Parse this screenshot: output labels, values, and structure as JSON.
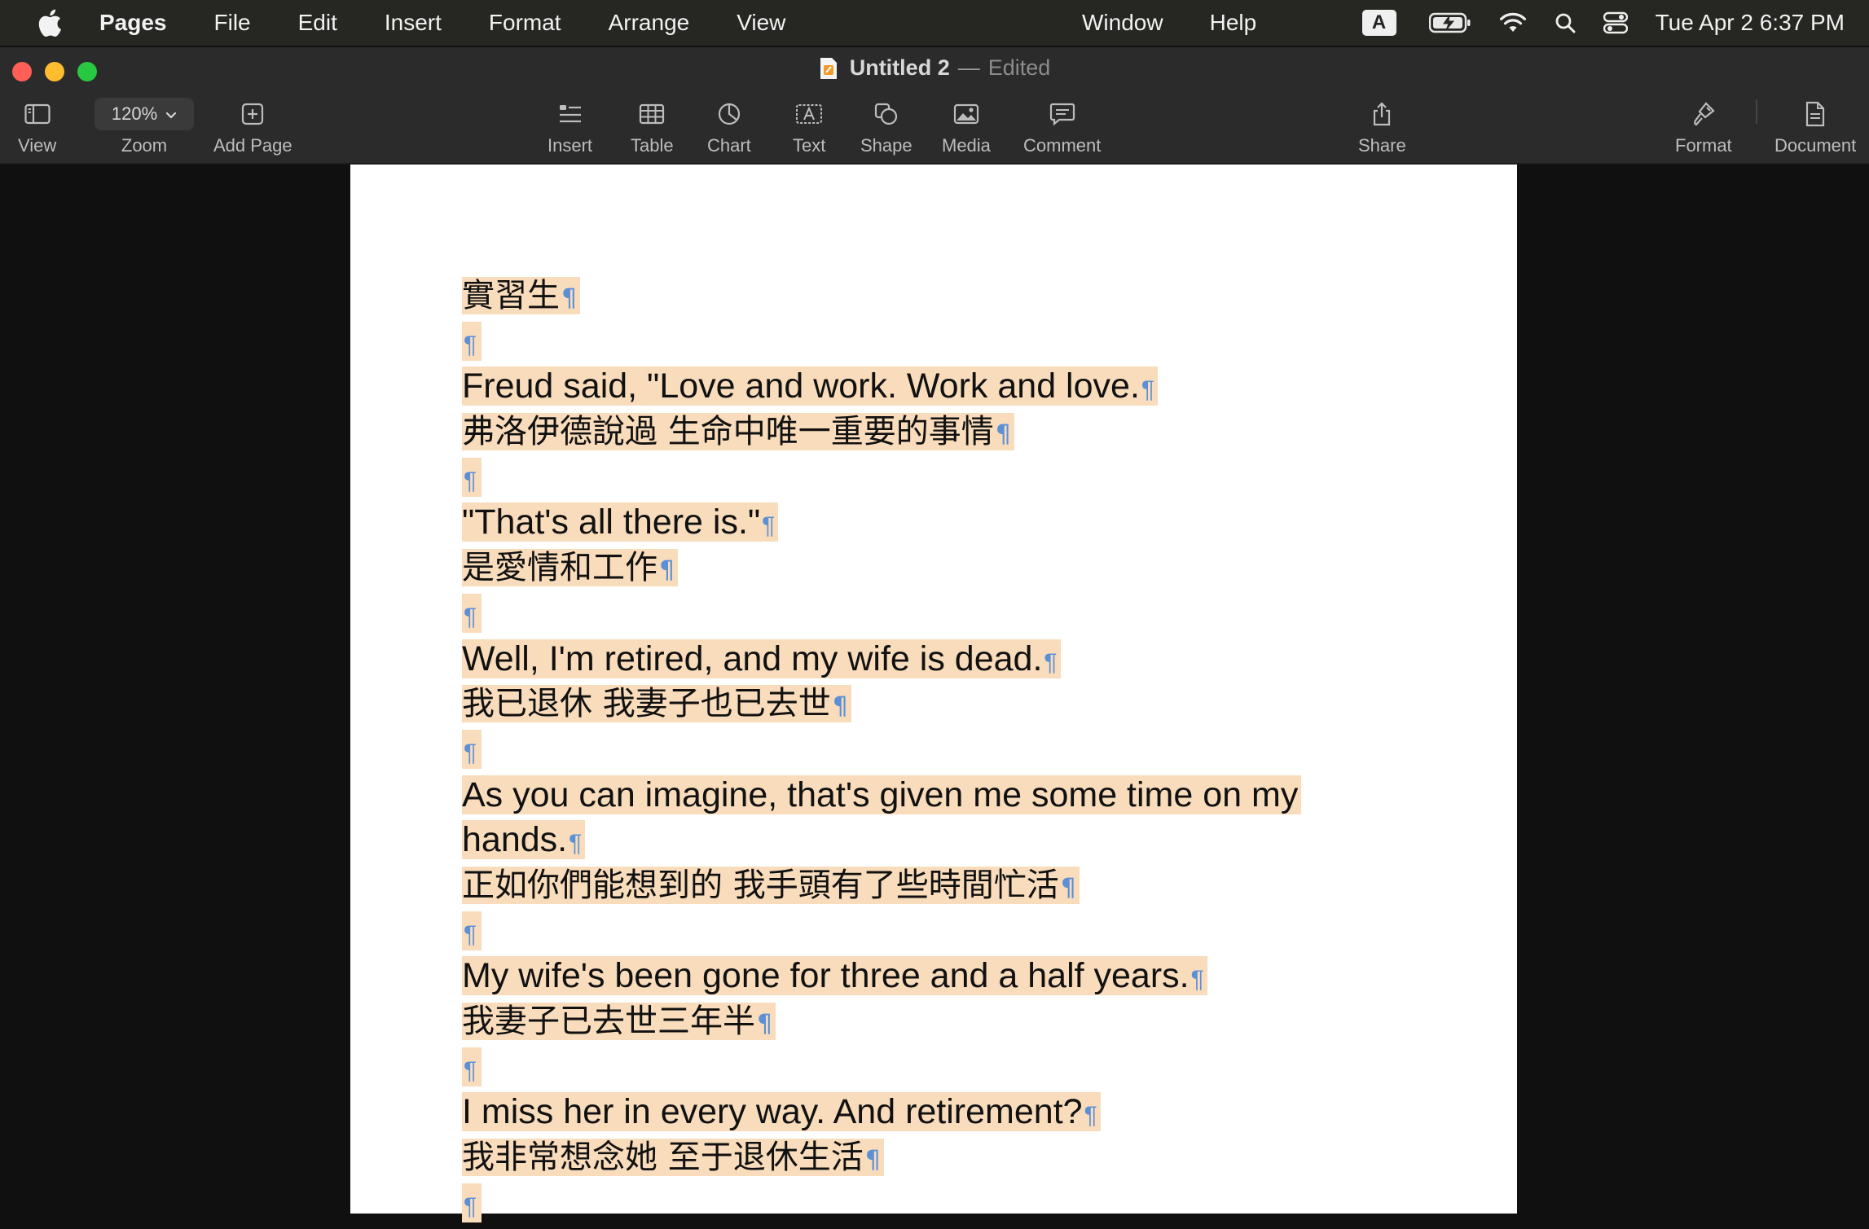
{
  "menubar": {
    "app_name": "Pages",
    "menus": [
      "File",
      "Edit",
      "Insert",
      "Format",
      "Arrange",
      "View"
    ],
    "right_menus": [
      "Window",
      "Help"
    ],
    "input_source": "A",
    "clock": "Tue Apr 2  6:37 PM"
  },
  "window": {
    "title": "Untitled 2",
    "separator": "—",
    "status": "Edited"
  },
  "toolbar": {
    "view_label": "View",
    "zoom_value": "120%",
    "zoom_label": "Zoom",
    "add_page_label": "Add Page",
    "insert_label": "Insert",
    "table_label": "Table",
    "chart_label": "Chart",
    "text_label": "Text",
    "shape_label": "Shape",
    "media_label": "Media",
    "comment_label": "Comment",
    "share_label": "Share",
    "format_label": "Format",
    "document_label": "Document"
  },
  "document": {
    "pilcrow": "¶",
    "lines": [
      "實習生",
      "",
      "Freud said, \"Love and work. Work and love.",
      "弗洛伊德說過  生命中唯一重要的事情",
      "",
      "\"That's all there is.\"",
      "是愛情和工作",
      "",
      "Well, I'm retired, and my wife is dead.",
      "我已退休  我妻子也已去世",
      "",
      "As you can imagine, that's given me some time on my ",
      "hands.",
      "正如你們能想到的  我手頭有了些時間忙活",
      "",
      "My wife's been gone for three and a half years.",
      "我妻子已去世三年半",
      "",
      "I miss her in every way. And retirement?",
      "我非常想念她  至于退休生活",
      ""
    ]
  },
  "colors": {
    "selection_highlight": "#f8dcbb",
    "pilcrow": "#5b8fd6",
    "close": "#ff5f57",
    "minimize": "#febc2e",
    "maximize": "#28c840"
  }
}
